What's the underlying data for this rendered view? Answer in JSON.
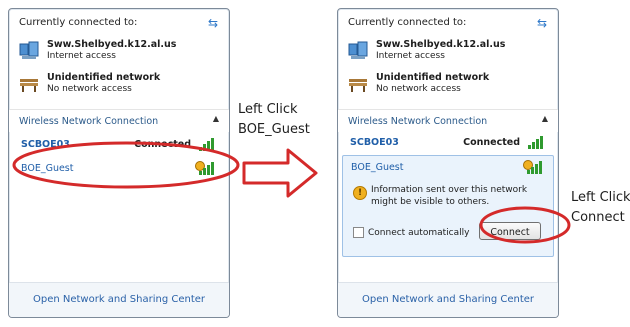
{
  "left_panel": {
    "header": "Currently connected to:",
    "connected": [
      {
        "name": "Sww.Shelbyed.k12.al.us",
        "status": "Internet access"
      },
      {
        "name": "Unidentified network",
        "status": "No network access"
      }
    ],
    "section_label": "Wireless Network Connection",
    "wifi": [
      {
        "name": "SCBOE03",
        "status": "Connected"
      },
      {
        "name": "BOE_Guest",
        "status": ""
      }
    ],
    "footer_link": "Open Network and Sharing Center"
  },
  "right_panel": {
    "header": "Currently connected to:",
    "connected": [
      {
        "name": "Sww.Shelbyed.k12.al.us",
        "status": "Internet access"
      },
      {
        "name": "Unidentified network",
        "status": "No network access"
      }
    ],
    "section_label": "Wireless Network Connection",
    "wifi": [
      {
        "name": "SCBOE03",
        "status": "Connected"
      },
      {
        "name": "BOE_Guest",
        "status": ""
      }
    ],
    "info_text": "Information sent over this network might be visible to others.",
    "auto_label": "Connect automatically",
    "connect_label": "Connect",
    "footer_link": "Open Network and Sharing Center"
  },
  "annotations": {
    "left": [
      "Left Click",
      "BOE_Guest"
    ],
    "right": [
      "Left Click",
      "Connect"
    ]
  },
  "colors": {
    "highlight": "#d42a2a",
    "signal": "#2f9a2f",
    "link": "#2b62a8"
  }
}
